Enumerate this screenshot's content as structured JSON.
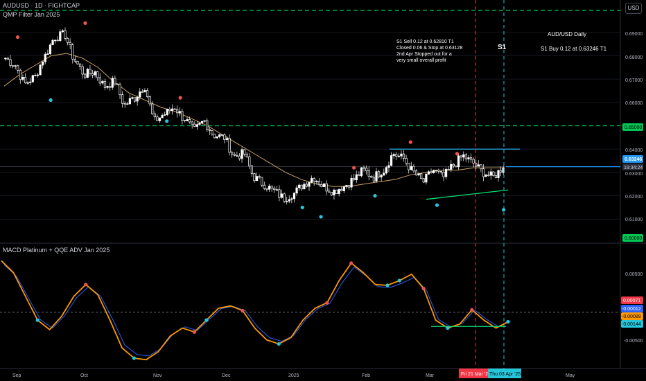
{
  "symbol_header": "AUDUSD · 1D · FIGHTCAP",
  "indicator_name": "QMP Filter Jan 2025",
  "currency_label": "USD",
  "signal_label": "S1",
  "annotations": {
    "trade_note_lines": [
      "S1 Sell 0.12 at 0.62810 T1",
      "Closed 0.06 & Stop at 0.63128",
      "2nd Apr Stopped out for a",
      "very small overall profit"
    ],
    "daily_title": "AUD/USD Daily",
    "buy_note": "S1 Buy 0.12 at 0.63246 T1"
  },
  "price_axis": {
    "ticks": [
      "0.69000",
      "0.68000",
      "0.67000",
      "0.66000",
      "0.65000",
      "0.64000",
      "0.63000",
      "0.62000",
      "0.61000",
      "0.60000"
    ],
    "current_price": "0.63246",
    "countdown": "19:34:24",
    "level_upper": "0.65000",
    "level_lower": "0.60000"
  },
  "time_axis": {
    "labels": [
      "Sep",
      "Oct",
      "Nov",
      "Dec",
      "2025",
      "Feb",
      "Mar",
      "May"
    ],
    "highlight_left": "Fri 21 Mar '25",
    "highlight_right": "Thu 03 Apr '25"
  },
  "macd_panel": {
    "title": "MACD Platinum + QQE ADV Jan 2025",
    "ticks": [
      "0.00500",
      "-0.00500"
    ],
    "value_labels": [
      "0.00071",
      "-0.00012",
      "-0.00089",
      "-0.00144"
    ],
    "value_label_colors": [
      "#f23645",
      "#2962ff",
      "#ff9800",
      "#26c6da"
    ]
  },
  "chart_data": [
    {
      "type": "candlestick",
      "title": "AUDUSD · 1D · FIGHTCAP",
      "x_range": [
        "Aug 2024",
        "May 2025"
      ],
      "ylim": [
        0.6,
        0.695
      ],
      "ylabel": "USD",
      "series": [
        {
          "name": "AUDUSD",
          "close_approx": [
            0.679,
            0.676,
            0.668,
            0.671,
            0.68,
            0.688,
            0.689,
            0.678,
            0.672,
            0.673,
            0.667,
            0.669,
            0.659,
            0.662,
            0.667,
            0.652,
            0.655,
            0.658,
            0.653,
            0.648,
            0.652,
            0.646,
            0.645,
            0.637,
            0.638,
            0.628,
            0.625,
            0.622,
            0.619,
            0.621,
            0.625,
            0.628,
            0.624,
            0.622,
            0.624,
            0.627,
            0.631,
            0.628,
            0.631,
            0.638,
            0.636,
            0.63,
            0.626,
            0.631,
            0.628,
            0.633,
            0.637,
            0.634,
            0.63,
            0.628,
            0.632
          ]
        },
        {
          "name": "Moving average",
          "values_approx": [
            0.667,
            0.672,
            0.676,
            0.68,
            0.681,
            0.679,
            0.675,
            0.669,
            0.664,
            0.661,
            0.658,
            0.656,
            0.653,
            0.65,
            0.646,
            0.642,
            0.638,
            0.634,
            0.63,
            0.627,
            0.625,
            0.624,
            0.624,
            0.625,
            0.626,
            0.627,
            0.629,
            0.63,
            0.631,
            0.631,
            0.632,
            0.632,
            0.632
          ]
        }
      ],
      "levels": [
        0.65,
        0.6,
        0.63246
      ],
      "resistance": 0.64
    },
    {
      "type": "line",
      "title": "MACD Platinum + QQE ADV Jan 2025",
      "ylim": [
        -0.0065,
        0.0075
      ],
      "series": [
        {
          "name": "MACD",
          "values_approx": [
            0.0065,
            0.005,
            0.002,
            -0.001,
            -0.0022,
            -0.0005,
            0.002,
            0.0035,
            0.0022,
            -0.001,
            -0.0045,
            -0.0058,
            -0.006,
            -0.005,
            -0.003,
            -0.002,
            -0.0025,
            -0.001,
            0.0005,
            0.0008,
            0.0002,
            -0.002,
            -0.0035,
            -0.004,
            -0.0032,
            -0.001,
            0.0005,
            0.0012,
            0.004,
            0.0062,
            0.005,
            0.0035,
            0.0034,
            0.004,
            0.0048,
            0.003,
            -0.001,
            -0.002,
            -0.0015,
            0.0003,
            -0.001,
            -0.002,
            -0.0012
          ]
        }
      ],
      "zero_line": 0.0
    }
  ]
}
